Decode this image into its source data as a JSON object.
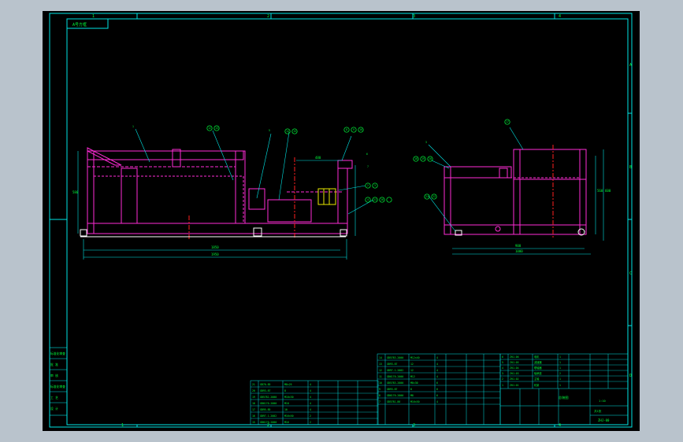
{
  "colors": {
    "background": "#b9c3cc",
    "canvas": "#000000",
    "frame": "#00e5e5",
    "part_outline": "#ff2bd6",
    "text": "#00ff3c",
    "yellow": "#e8e800",
    "white": "#ffffff",
    "red": "#ff2020"
  },
  "drawing": {
    "ref_box": "A号方框",
    "zone_numbers": [
      "1",
      "2",
      "3",
      "4"
    ],
    "zone_letters": [
      "A",
      "B",
      "C",
      "D"
    ],
    "bottom_zone_numbers": [
      "1",
      "2",
      "3",
      "4"
    ]
  },
  "front_view": {
    "balloons": [
      "1",
      "2",
      "3",
      "4",
      "5",
      "6",
      "7",
      "8",
      "9",
      "10",
      "11",
      "12",
      "13",
      "14",
      "15",
      "16"
    ],
    "dimensions": {
      "top": "480",
      "overall_1": "1850",
      "overall_2": "1950",
      "height": "580"
    }
  },
  "side_view": {
    "balloons": [
      "3",
      "17",
      "18",
      "19",
      "20",
      "21",
      "22"
    ],
    "dimensions": {
      "width_1": "900",
      "width_2": "1000",
      "height_1": "560",
      "height_2": "600"
    }
  },
  "signoff_table": {
    "rows": [
      "标准化审查",
      "批 准",
      "审 核",
      "标准化审查",
      "工 艺",
      "设 计"
    ]
  },
  "bom_left": {
    "rows": [
      [
        "21",
        "GB70-85",
        "M8×25",
        "4"
      ],
      [
        "20",
        "GB93-87",
        "8",
        "4"
      ],
      [
        "19",
        "GB5782-2000",
        "M10×30",
        "4"
      ],
      [
        "18",
        "GB6170-2000",
        "M10",
        "4"
      ],
      [
        "17",
        "GB95-85",
        "10",
        "4"
      ],
      [
        "16",
        "GB97.1-2002",
        "M16×50",
        "2"
      ],
      [
        "15",
        "GB6170-2000",
        "M16",
        "2"
      ]
    ]
  },
  "bom_right": {
    "rows": [
      [
        "14",
        "GB5783-2000",
        "M12×40",
        "4"
      ],
      [
        "13",
        "GB93-87",
        "12",
        "4"
      ],
      [
        "12",
        "GB97.1-2002",
        "12",
        "4"
      ],
      [
        "11",
        "GB6170-2000",
        "M12",
        "4"
      ],
      [
        "10",
        "GB5783-2000",
        "M8×30",
        "6"
      ],
      [
        "9",
        "GB93-87",
        "8",
        "6"
      ],
      [
        "8",
        "GB6170-2000",
        "M8",
        "6"
      ],
      [
        "7",
        "GB5781-86",
        "M16×50",
        "4"
      ]
    ]
  },
  "title_block": {
    "parts": [
      [
        "6",
        "ZHJ-06",
        "电机",
        "1"
      ],
      [
        "5",
        "ZHJ-05",
        "减速器",
        "1"
      ],
      [
        "4",
        "ZHJ-04",
        "联轴器",
        "1"
      ],
      [
        "3",
        "ZHJ-03",
        "轴承座",
        "2"
      ],
      [
        "2",
        "ZHJ-02",
        "主轴",
        "1"
      ],
      [
        "1",
        "ZHJ-01",
        "机架",
        "1"
      ]
    ],
    "drawing_title": "总装图",
    "scale": "1:10",
    "sheet": "共1张",
    "number": "ZHJ-00"
  }
}
